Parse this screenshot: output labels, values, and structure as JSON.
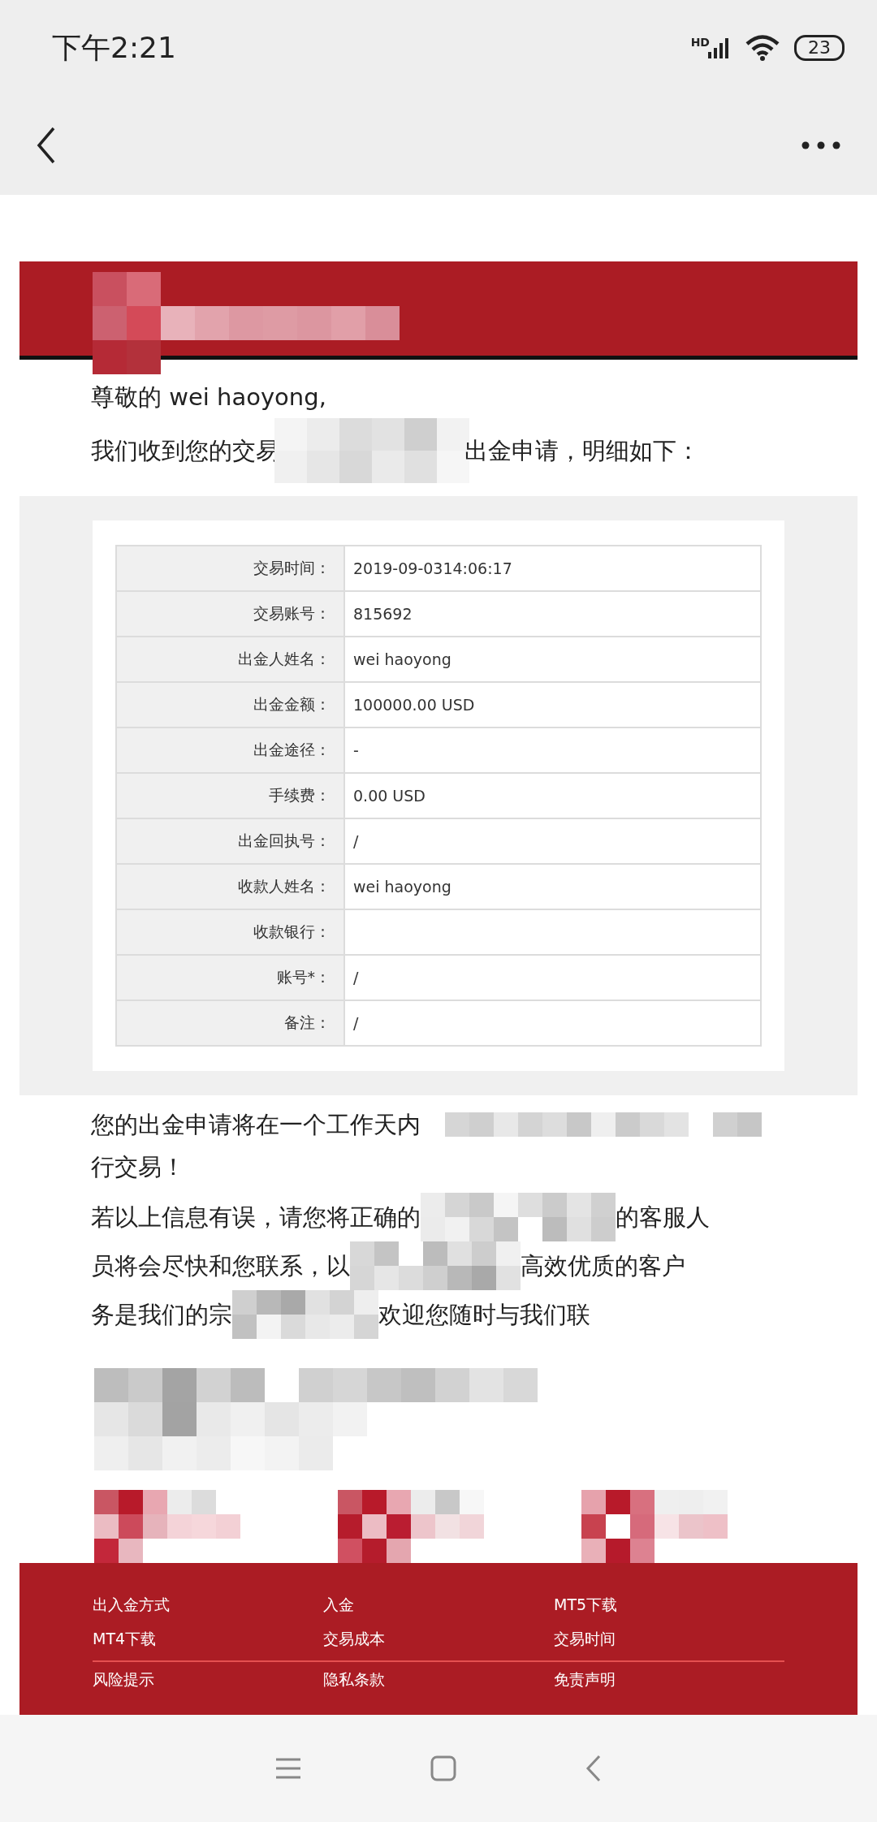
{
  "status_bar": {
    "time": "下午2:21",
    "network": "HD",
    "battery": "23"
  },
  "greeting": {
    "salutation": "尊敬的 wei haoyong,",
    "intro_start": "我们收到您的交易",
    "intro_end": "出金申请，明细如下："
  },
  "details": [
    {
      "label": "交易时间：",
      "value": "2019-09-0314:06:17"
    },
    {
      "label": "交易账号：",
      "value": "815692"
    },
    {
      "label": "出金人姓名：",
      "value": "wei haoyong"
    },
    {
      "label": "出金金额：",
      "value": "100000.00 USD"
    },
    {
      "label": "出金途径：",
      "value": "-"
    },
    {
      "label": "手续费：",
      "value": "0.00 USD"
    },
    {
      "label": "出金回执号：",
      "value": "/"
    },
    {
      "label": "收款人姓名：",
      "value": "wei haoyong"
    },
    {
      "label": "收款银行："
    },
    {
      "label": "账号*：",
      "value": "/"
    },
    {
      "label": "备注：",
      "value": "/"
    }
  ],
  "notice": {
    "line_1": "您的出金申请将在一个工作天内",
    "line_2": "行交易！"
  },
  "contact": [
    {
      "start": "若以上信息有误，请您将正确的",
      "end": "的客服人"
    },
    {
      "start": "员将会尽快和您联系，以",
      "end": "高效优质的客户"
    },
    {
      "start": "务是我们的宗",
      "end": "欢迎您随时与我们联"
    }
  ],
  "footer": {
    "links": [
      [
        "出入金方式",
        "入金",
        "MT5下载"
      ],
      [
        "MT4下载",
        "交易成本",
        "交易时间"
      ],
      [
        "风险提示",
        "隐私条款",
        "免责声明"
      ]
    ]
  }
}
